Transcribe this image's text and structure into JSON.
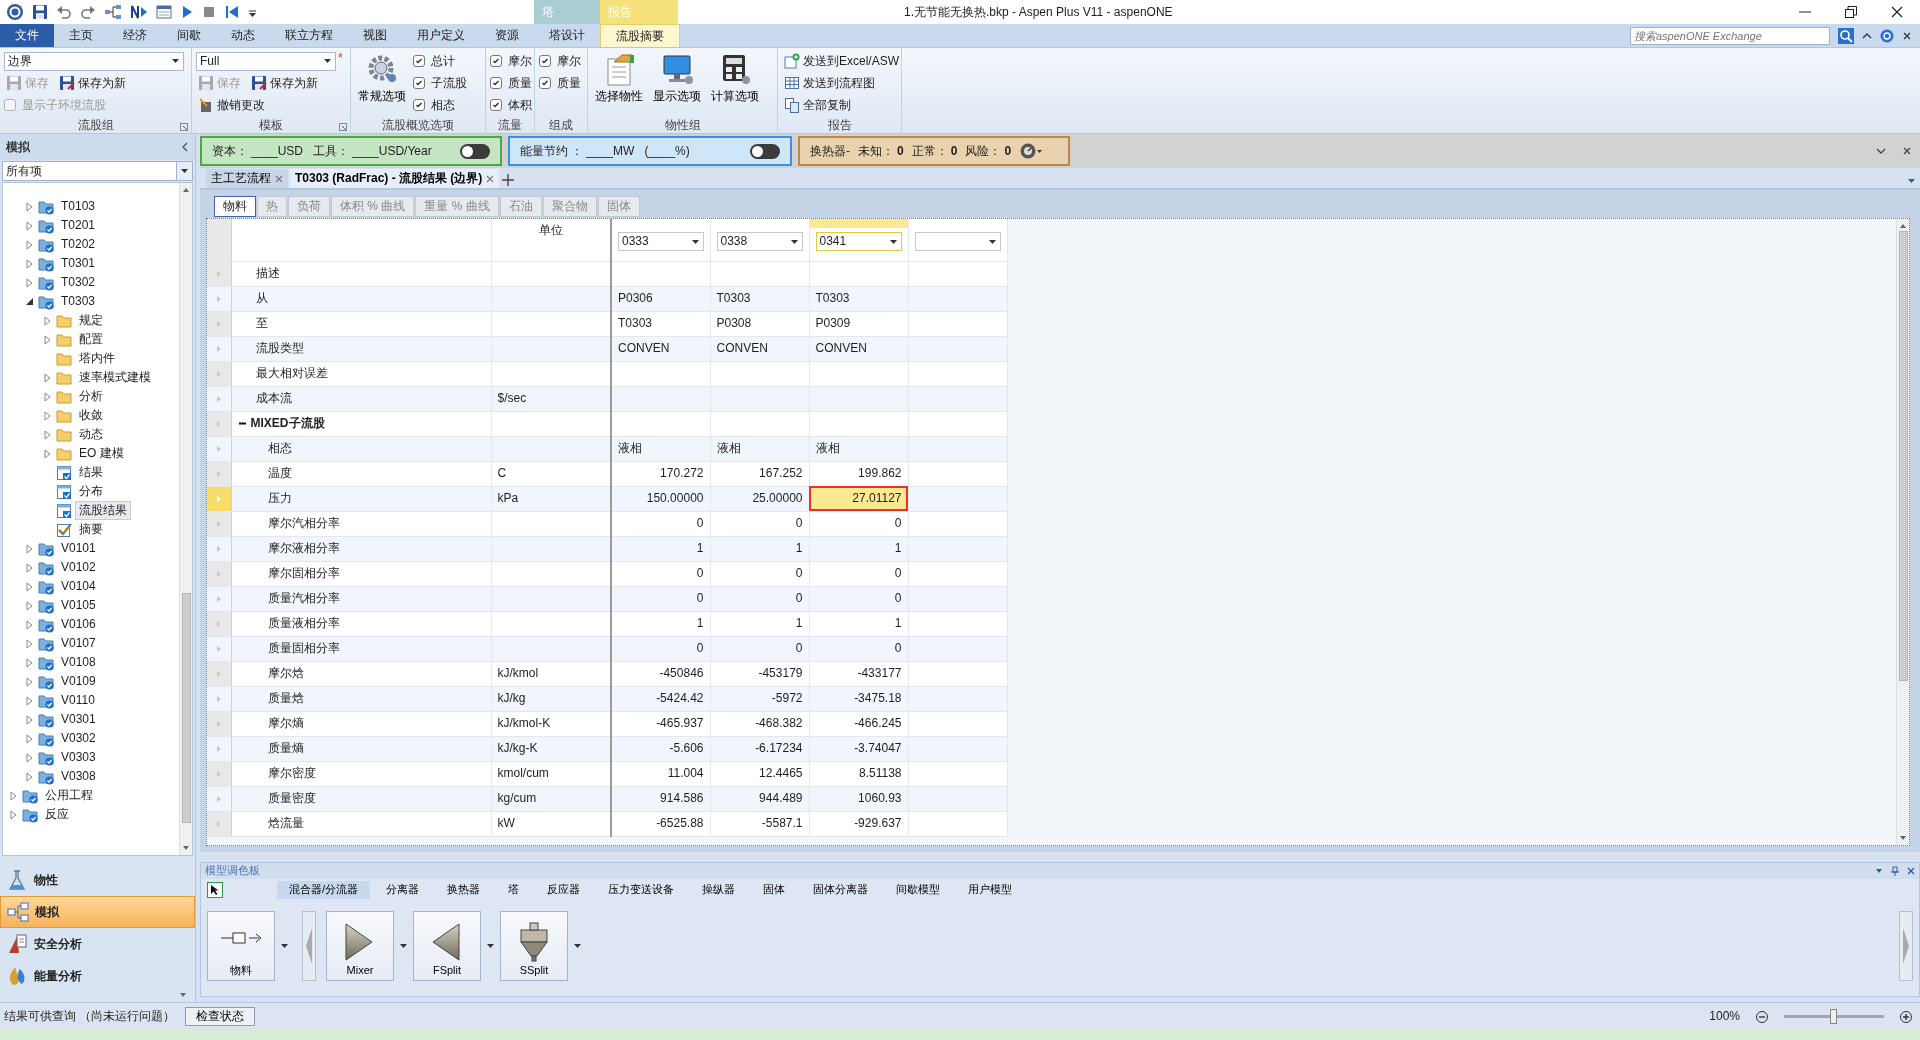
{
  "title_bar": {
    "title": "1.无节能无换热.bkp - Aspen Plus V11 - aspenONE",
    "context_tabs": [
      {
        "label": "塔",
        "color": "#a8cdd3"
      },
      {
        "label": "报告",
        "color": "#f6e27a"
      }
    ]
  },
  "menu_tabs": [
    {
      "label": "文件",
      "kind": "file",
      "selected": false
    },
    {
      "label": "主页",
      "kind": "tab",
      "selected": false
    },
    {
      "label": "经济",
      "kind": "tab",
      "selected": false
    },
    {
      "label": "间歇",
      "kind": "tab",
      "selected": false
    },
    {
      "label": "动态",
      "kind": "tab",
      "selected": false
    },
    {
      "label": "联立方程",
      "kind": "tab",
      "selected": false
    },
    {
      "label": "视图",
      "kind": "tab",
      "selected": false
    },
    {
      "label": "用户定义",
      "kind": "tab",
      "selected": false
    },
    {
      "label": "资源",
      "kind": "tab",
      "selected": false
    },
    {
      "label": "塔设计",
      "kind": "tab",
      "selected": false
    },
    {
      "label": "流股摘要",
      "kind": "tab",
      "selected": true
    }
  ],
  "search": {
    "placeholder": "搜索aspenONE Exchange"
  },
  "ribbon_groups": [
    {
      "title": "流股组",
      "has_launcher": true,
      "rows": [
        [
          {
            "kind": "select",
            "value": "边界"
          }
        ],
        [
          {
            "kind": "button",
            "label": "保存",
            "disabled": true
          },
          {
            "kind": "button",
            "label": "保存为新",
            "disabled": false
          }
        ],
        [
          {
            "kind": "checkbox",
            "label": "显示子环境流股",
            "checked": false,
            "disabled": true
          }
        ]
      ]
    },
    {
      "title": "模板",
      "has_launcher": true,
      "rows": [
        [
          {
            "kind": "select",
            "value": "Full",
            "modified_mark": "*"
          }
        ],
        [
          {
            "kind": "button",
            "label": "保存",
            "disabled": true
          },
          {
            "kind": "button",
            "label": "保存为新",
            "disabled": false
          }
        ],
        [
          {
            "kind": "button",
            "label": "撤销更改",
            "disabled": false
          }
        ]
      ]
    },
    {
      "title": "流股概览选项",
      "has_launcher": false,
      "big_buttons": [
        {
          "label": "常规选项"
        }
      ],
      "rows": [
        [
          {
            "kind": "checkbox",
            "label": "总计",
            "checked": true,
            "disabled": false
          }
        ],
        [
          {
            "kind": "checkbox",
            "label": "子流股",
            "checked": true,
            "disabled": false
          }
        ],
        [
          {
            "kind": "checkbox",
            "label": "相态",
            "checked": true,
            "disabled": false
          }
        ]
      ]
    },
    {
      "title": "流量",
      "has_launcher": false,
      "rows": [
        [
          {
            "kind": "checkbox",
            "label": "摩尔",
            "checked": true,
            "disabled": false
          }
        ],
        [
          {
            "kind": "checkbox",
            "label": "质量",
            "checked": true,
            "disabled": false
          }
        ],
        [
          {
            "kind": "checkbox",
            "label": "体积",
            "checked": true,
            "disabled": false
          }
        ]
      ]
    },
    {
      "title": "组成",
      "has_launcher": false,
      "rows": [
        [
          {
            "kind": "checkbox",
            "label": "摩尔",
            "checked": true,
            "disabled": false
          }
        ],
        [
          {
            "kind": "checkbox",
            "label": "质量",
            "checked": true,
            "disabled": false
          }
        ]
      ]
    },
    {
      "title": "物性组",
      "has_launcher": false,
      "big_buttons": [
        {
          "label": "选择物性"
        },
        {
          "label": "显示选项"
        },
        {
          "label": "计算选项"
        }
      ]
    },
    {
      "title": "报告",
      "has_launcher": false,
      "rows": [
        [
          {
            "kind": "button",
            "label": "发送到Excel/ASW",
            "disabled": false
          }
        ],
        [
          {
            "kind": "button",
            "label": "发送到流程图",
            "disabled": false
          }
        ],
        [
          {
            "kind": "button",
            "label": "全部复制",
            "disabled": false
          }
        ]
      ]
    }
  ],
  "info_panels": [
    {
      "kind": "cost",
      "color": "#c5e5c3",
      "fields": [
        {
          "label": "资本：",
          "value": "____USD"
        },
        {
          "label": "工具：",
          "value": "____USD/Year"
        }
      ],
      "toggle": {
        "on": false
      }
    },
    {
      "kind": "energy",
      "color": "#cfe5f8",
      "fields": [
        {
          "label": "能量节约 ：",
          "value": "____MW"
        },
        {
          "value": "(____%)"
        }
      ],
      "toggle": {
        "on": false
      }
    },
    {
      "kind": "hx",
      "color": "#e9d2ad",
      "title": "换热器-",
      "fields": [
        {
          "label": "未知：",
          "value": "0"
        },
        {
          "label": "正常：",
          "value": "0"
        },
        {
          "label": "风险：",
          "value": "0"
        }
      ]
    }
  ],
  "left_panel": {
    "title": "模拟",
    "filter": "所有项",
    "tree": {
      "nested_items": [
        {
          "label": "T0103",
          "kind": "block",
          "expanded": false,
          "selected": false
        },
        {
          "label": "T0201",
          "kind": "block",
          "expanded": false,
          "selected": false
        },
        {
          "label": "T0202",
          "kind": "block",
          "expanded": false,
          "selected": false
        },
        {
          "label": "T0301",
          "kind": "block",
          "expanded": false,
          "selected": false
        },
        {
          "label": "T0302",
          "kind": "block",
          "expanded": false,
          "selected": false
        },
        {
          "label": "T0303",
          "kind": "block",
          "expanded": true,
          "selected": false,
          "children": [
            {
              "label": "规定",
              "kind": "folder",
              "expanded": false,
              "selected": false
            },
            {
              "label": "配置",
              "kind": "folder",
              "expanded": false,
              "selected": false
            },
            {
              "label": "塔内件",
              "kind": "folder",
              "selected": false
            },
            {
              "label": "速率模式建模",
              "kind": "folder",
              "expanded": false,
              "selected": false
            },
            {
              "label": "分析",
              "kind": "folder",
              "expanded": false,
              "selected": false
            },
            {
              "label": "收敛",
              "kind": "folder",
              "expanded": false,
              "selected": false
            },
            {
              "label": "动态",
              "kind": "folder",
              "expanded": false,
              "selected": false
            },
            {
              "label": "EO 建模",
              "kind": "folder",
              "expanded": false,
              "selected": false
            },
            {
              "label": "结果",
              "kind": "form",
              "selected": false
            },
            {
              "label": "分布",
              "kind": "form",
              "selected": false
            },
            {
              "label": "流股结果",
              "kind": "form",
              "selected": true
            },
            {
              "label": "摘要",
              "kind": "check",
              "selected": false
            }
          ]
        },
        {
          "label": "V0101",
          "kind": "block",
          "expanded": false,
          "selected": false
        },
        {
          "label": "V0102",
          "kind": "block",
          "expanded": false,
          "selected": false
        },
        {
          "label": "V0104",
          "kind": "block",
          "expanded": false,
          "selected": false
        },
        {
          "label": "V0105",
          "kind": "block",
          "expanded": false,
          "selected": false
        },
        {
          "label": "V0106",
          "kind": "block",
          "expanded": false,
          "selected": false
        },
        {
          "label": "V0107",
          "kind": "block",
          "expanded": false,
          "selected": false
        },
        {
          "label": "V0108",
          "kind": "block",
          "expanded": false,
          "selected": false
        },
        {
          "label": "V0109",
          "kind": "block",
          "expanded": false,
          "selected": false
        },
        {
          "label": "V0110",
          "kind": "block",
          "expanded": false,
          "selected": false
        },
        {
          "label": "V0301",
          "kind": "block",
          "expanded": false,
          "selected": false
        },
        {
          "label": "V0302",
          "kind": "block",
          "expanded": false,
          "selected": false
        },
        {
          "label": "V0303",
          "kind": "block",
          "expanded": false,
          "selected": false
        },
        {
          "label": "V0308",
          "kind": "block",
          "expanded": false,
          "selected": false
        }
      ],
      "top_items": [
        {
          "label": "公用工程",
          "kind": "block",
          "expanded": false,
          "selected": false
        },
        {
          "label": "反应",
          "kind": "block",
          "expanded": false,
          "selected": false
        }
      ]
    },
    "nav_buttons": [
      {
        "label": "物性",
        "kind": "properties",
        "selected": false
      },
      {
        "label": "模拟",
        "kind": "simulation",
        "selected": true
      },
      {
        "label": "安全分析",
        "kind": "safety",
        "selected": false
      },
      {
        "label": "能量分析",
        "kind": "energy",
        "selected": false
      }
    ]
  },
  "doc_tabs": [
    {
      "label": "主工艺流程",
      "selected": false
    },
    {
      "label": "T0303 (RadFrac) - 流股结果 (边界)",
      "selected": true
    }
  ],
  "sheet_tabs": [
    {
      "label": "物料",
      "selected": true
    },
    {
      "label": "热",
      "selected": false
    },
    {
      "label": "负荷",
      "selected": false
    },
    {
      "label": "体积 % 曲线",
      "selected": false
    },
    {
      "label": "重量 % 曲线",
      "selected": false
    },
    {
      "label": "石油",
      "selected": false
    },
    {
      "label": "聚合物",
      "selected": false
    },
    {
      "label": "固体",
      "selected": false
    }
  ],
  "table": {
    "unit_header": "单位",
    "stream_columns": [
      {
        "kind": "select",
        "value": "0333",
        "selected": false
      },
      {
        "kind": "select",
        "value": "0338",
        "selected": false
      },
      {
        "kind": "select",
        "value": "0341",
        "selected": true
      },
      {
        "kind": "empty",
        "selected": false
      }
    ],
    "rows": [
      {
        "label": "描述",
        "kind": "text",
        "selected": false
      },
      {
        "label": "从",
        "kind": "text",
        "selected": false,
        "values": [
          "P0306",
          "T0303",
          "T0303"
        ]
      },
      {
        "label": "至",
        "kind": "text",
        "selected": false,
        "values": [
          "T0303",
          "P0308",
          "P0309"
        ]
      },
      {
        "label": "流股类型",
        "kind": "text",
        "selected": false,
        "values": [
          "CONVEN",
          "CONVEN",
          "CONVEN"
        ]
      },
      {
        "label": "最大相对误差",
        "kind": "text",
        "selected": false
      },
      {
        "label": "成本流",
        "unit": "$/sec",
        "kind": "text",
        "selected": false
      },
      {
        "label": "MIXED子流股",
        "kind": "group",
        "expanded": true,
        "selected": false,
        "children": [
          {
            "label": "相态",
            "kind": "text",
            "selected": false,
            "values": [
              "液相",
              "液相",
              "液相"
            ]
          },
          {
            "label": "温度",
            "unit": "C",
            "kind": "number",
            "selected": false,
            "values": [
              "170.272",
              "167.252",
              "199.862"
            ]
          },
          {
            "label": "压力",
            "unit": "kPa",
            "kind": "number",
            "selected": true,
            "values": [
              "150.00000",
              "25.00000",
              "27.01127"
            ]
          },
          {
            "label": "摩尔汽相分率",
            "kind": "number",
            "selected": false,
            "values": [
              "0",
              "0",
              "0"
            ]
          },
          {
            "label": "摩尔液相分率",
            "kind": "number",
            "selected": false,
            "values": [
              "1",
              "1",
              "1"
            ]
          },
          {
            "label": "摩尔固相分率",
            "kind": "number",
            "selected": false,
            "values": [
              "0",
              "0",
              "0"
            ]
          },
          {
            "label": "质量汽相分率",
            "kind": "number",
            "selected": false,
            "values": [
              "0",
              "0",
              "0"
            ]
          },
          {
            "label": "质量液相分率",
            "kind": "number",
            "selected": false,
            "values": [
              "1",
              "1",
              "1"
            ]
          },
          {
            "label": "质量固相分率",
            "kind": "number",
            "selected": false,
            "values": [
              "0",
              "0",
              "0"
            ]
          },
          {
            "label": "摩尔焓",
            "unit": "kJ/kmol",
            "kind": "number",
            "selected": false,
            "values": [
              "-450846",
              "-453179",
              "-433177"
            ]
          },
          {
            "label": "质量焓",
            "unit": "kJ/kg",
            "kind": "number",
            "selected": false,
            "values": [
              "-5424.42",
              "-5972",
              "-3475.18"
            ]
          },
          {
            "label": "摩尔熵",
            "unit": "kJ/kmol-K",
            "kind": "number",
            "selected": false,
            "values": [
              "-465.937",
              "-468.382",
              "-466.245"
            ]
          },
          {
            "label": "质量熵",
            "unit": "kJ/kg-K",
            "kind": "number",
            "selected": false,
            "values": [
              "-5.606",
              "-6.17234",
              "-3.74047"
            ]
          },
          {
            "label": "摩尔密度",
            "unit": "kmol/cum",
            "kind": "number",
            "selected": false,
            "values": [
              "11.004",
              "12.4465",
              "8.51138"
            ]
          },
          {
            "label": "质量密度",
            "unit": "kg/cum",
            "kind": "number",
            "selected": false,
            "values": [
              "914.586",
              "944.489",
              "1060.93"
            ]
          },
          {
            "label": "焓流量",
            "unit": "kW",
            "kind": "number",
            "selected": false,
            "values": [
              "-6525.88",
              "-5587.1",
              "-929.637"
            ]
          }
        ]
      }
    ]
  },
  "palette": {
    "title": "模型调色板",
    "tabs": [
      {
        "label": "混合器/分流器",
        "selected": true
      },
      {
        "label": "分离器",
        "selected": false
      },
      {
        "label": "换热器",
        "selected": false
      },
      {
        "label": "塔",
        "selected": false
      },
      {
        "label": "反应器",
        "selected": false
      },
      {
        "label": "压力变送设备",
        "selected": false
      },
      {
        "label": "操纵器",
        "selected": false
      },
      {
        "label": "固体",
        "selected": false
      },
      {
        "label": "固体分离器",
        "selected": false
      },
      {
        "label": "间歇模型",
        "selected": false
      },
      {
        "label": "用户模型",
        "selected": false
      }
    ],
    "stream": {
      "label": "物料"
    },
    "models": [
      {
        "label": "Mixer",
        "kind": "mixer"
      },
      {
        "label": "FSplit",
        "kind": "fsplit"
      },
      {
        "label": "SSplit",
        "kind": "ssplit"
      }
    ]
  },
  "status_bar": {
    "message": "结果可供查询 （尚未运行问题）",
    "button": "检查状态",
    "zoom": "100%",
    "zoom_slider": {
      "level": 0.5
    }
  }
}
